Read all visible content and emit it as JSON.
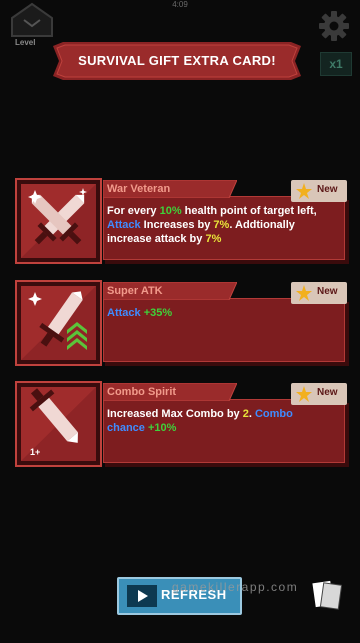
{
  "status_bar": {
    "time": "4:09"
  },
  "hud": {
    "level_label": "Level",
    "multiplier": "x1"
  },
  "banner": {
    "title": "SURVIVAL GIFT EXTRA CARD!"
  },
  "colors": {
    "card_red": "#7d1d1f",
    "card_border": "#c0423d",
    "name_color": "#f19a8b",
    "highlight_green": "#3fd13a",
    "highlight_blue": "#3f8cff",
    "highlight_yellow": "#e8e53a",
    "refresh_blue": "#3a8fb8"
  },
  "cards": [
    {
      "name": "War Veteran",
      "badge": "New",
      "icon": "crossed-swords-icon",
      "desc": [
        {
          "t": "For every ",
          "c": "w"
        },
        {
          "t": "10%",
          "c": "g"
        },
        {
          "t": " health point of target left, ",
          "c": "w"
        },
        {
          "t": "Attack",
          "c": "b"
        },
        {
          "t": " Increases by ",
          "c": "w"
        },
        {
          "t": "7%",
          "c": "y"
        },
        {
          "t": ". Addtionally increase attack by ",
          "c": "w"
        },
        {
          "t": "7%",
          "c": "y"
        }
      ]
    },
    {
      "name": "Super ATK",
      "badge": "New",
      "icon": "sword-upgrade-icon",
      "desc": [
        {
          "t": "Attack",
          "c": "b"
        },
        {
          "t": " ",
          "c": "w"
        },
        {
          "t": "+35%",
          "c": "g"
        }
      ]
    },
    {
      "name": "Combo Spirit",
      "badge": "New",
      "icon": "combo-sword-icon",
      "icon_text": "1+",
      "desc": [
        {
          "t": "Increased Max Combo by ",
          "c": "w"
        },
        {
          "t": "2",
          "c": "y"
        },
        {
          "t": ". ",
          "c": "w"
        },
        {
          "t": "Combo chance",
          "c": "b"
        },
        {
          "t": " ",
          "c": "w"
        },
        {
          "t": "+10%",
          "c": "g"
        }
      ]
    }
  ],
  "footer": {
    "refresh_label": "REFRESH",
    "watermark": "gamekillerapp.com"
  }
}
